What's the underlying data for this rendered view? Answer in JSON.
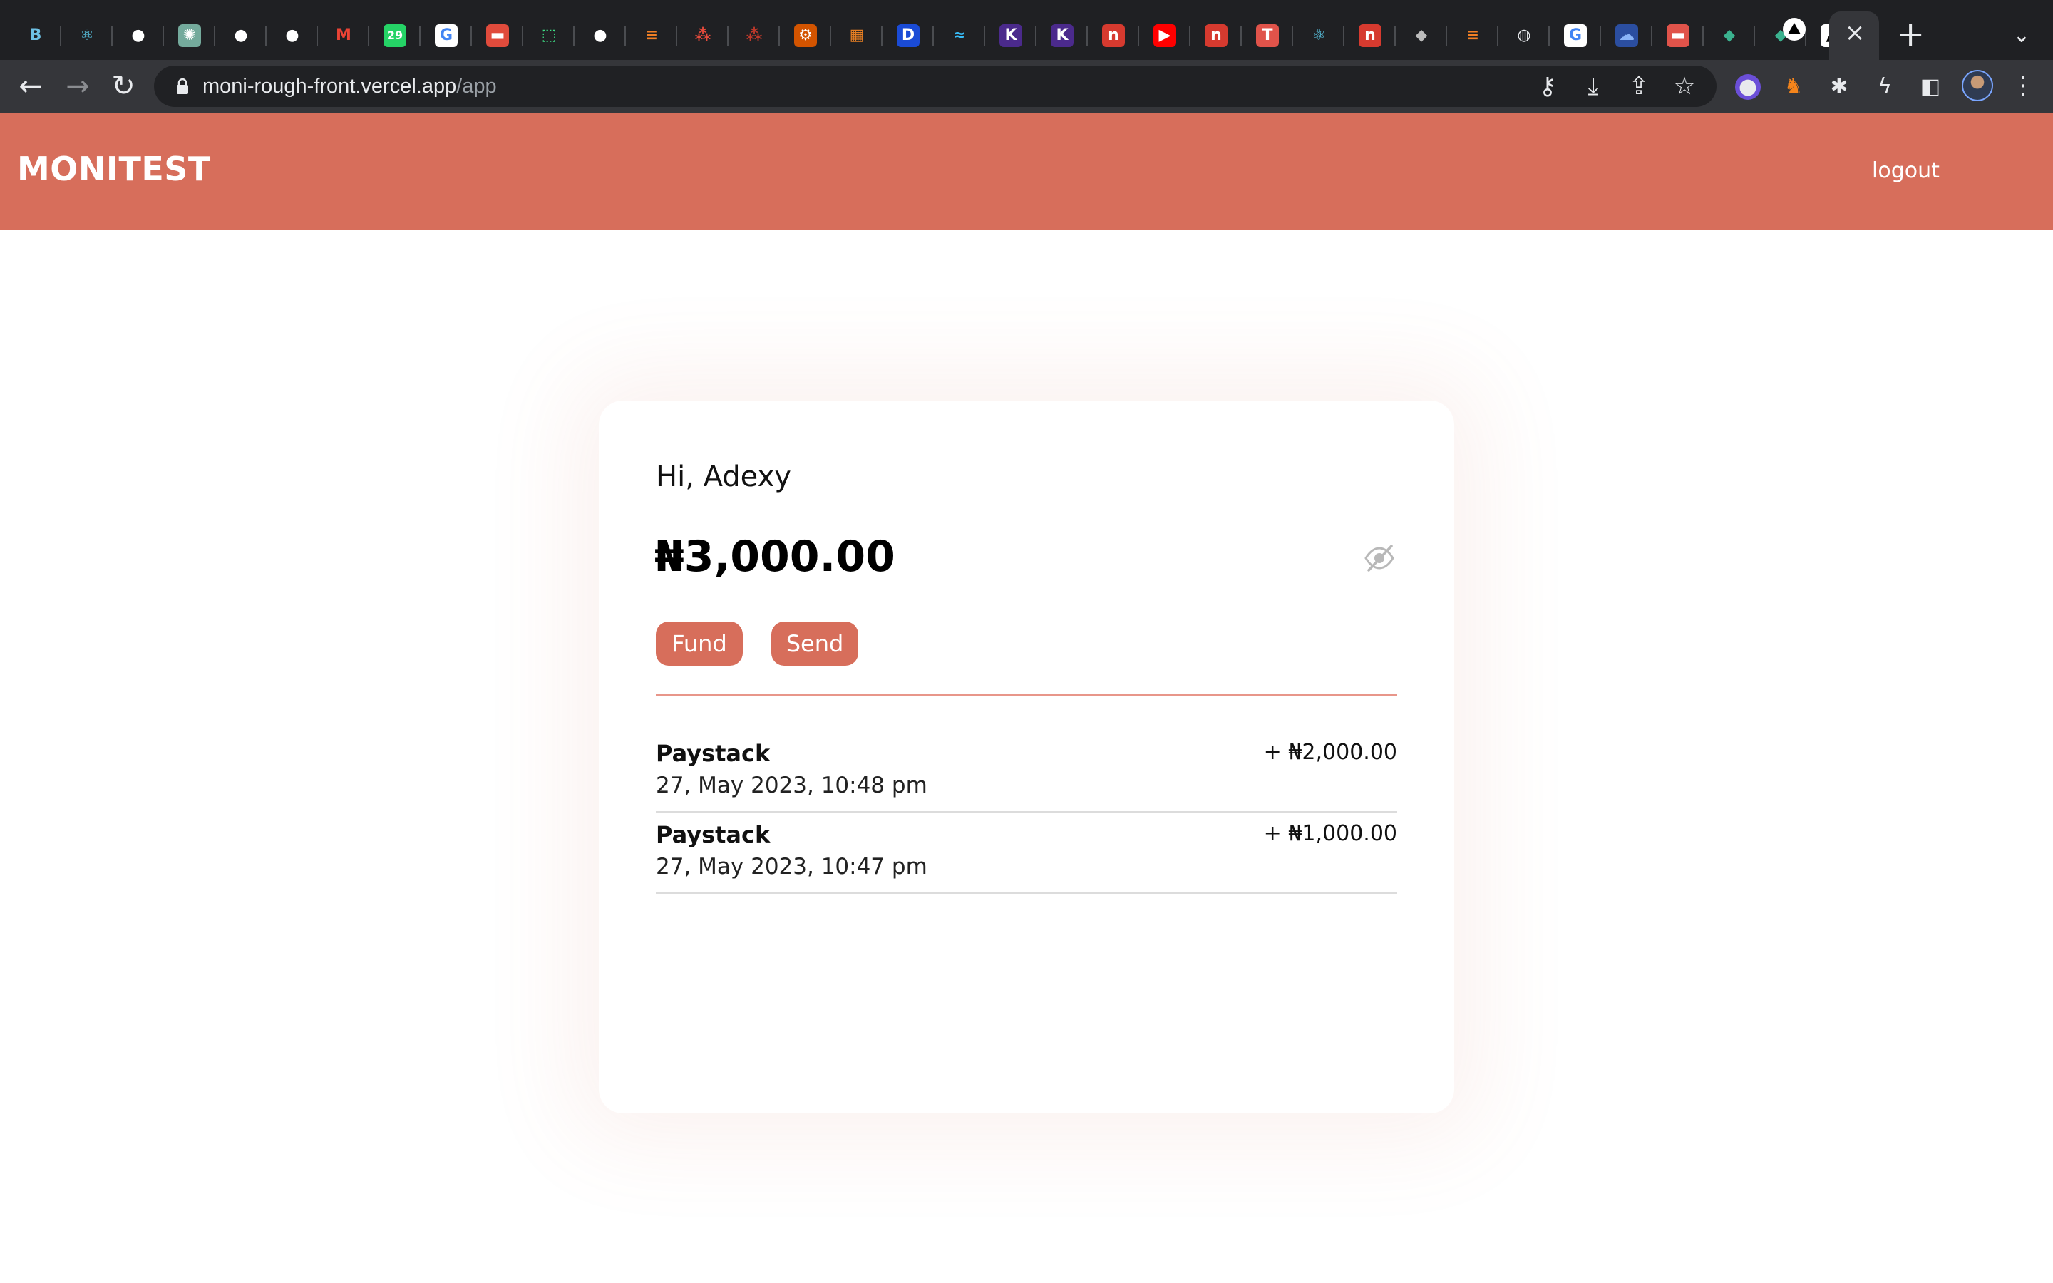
{
  "browser": {
    "tab_favicons": [
      {
        "icon": "bootstrap-icon",
        "glyph": "B",
        "color": "#6ec1e4",
        "bg": "transparent"
      },
      {
        "icon": "react-icon",
        "glyph": "⚛",
        "color": "#61dafb",
        "bg": "transparent"
      },
      {
        "icon": "github-icon",
        "glyph": "●",
        "color": "#ffffff",
        "bg": "transparent"
      },
      {
        "icon": "chatgpt-icon",
        "glyph": "✺",
        "color": "#ffffff",
        "bg": "#74aa9c"
      },
      {
        "icon": "github-icon",
        "glyph": "●",
        "color": "#ffffff",
        "bg": "transparent"
      },
      {
        "icon": "github-icon",
        "glyph": "●",
        "color": "#ffffff",
        "bg": "transparent"
      },
      {
        "icon": "gmail-icon",
        "glyph": "M",
        "color": "#ea4335",
        "bg": "transparent"
      },
      {
        "icon": "whatsapp-icon",
        "glyph": "29",
        "color": "#ffffff",
        "bg": "#25d366"
      },
      {
        "icon": "google-icon",
        "glyph": "G",
        "color": "#4285f4",
        "bg": "#ffffff"
      },
      {
        "icon": "red-app-icon",
        "glyph": "▬",
        "color": "#ffffff",
        "bg": "#e04b3c"
      },
      {
        "icon": "crop-icon",
        "glyph": "⬚",
        "color": "#3ddc84",
        "bg": "transparent"
      },
      {
        "icon": "github-icon",
        "glyph": "●",
        "color": "#ffffff",
        "bg": "transparent"
      },
      {
        "icon": "stackoverflow-icon",
        "glyph": "≡",
        "color": "#f48024",
        "bg": "transparent"
      },
      {
        "icon": "dots-app-icon",
        "glyph": "⁂",
        "color": "#e84b3c",
        "bg": "transparent"
      },
      {
        "icon": "dots-app-icon",
        "glyph": "⁂",
        "color": "#c0392b",
        "bg": "transparent"
      },
      {
        "icon": "gear-app-icon",
        "glyph": "⚙",
        "color": "#ffffff",
        "bg": "#d35400"
      },
      {
        "icon": "store-icon",
        "glyph": "▦",
        "color": "#e67e22",
        "bg": "transparent"
      },
      {
        "icon": "devtools-icon",
        "glyph": "D",
        "color": "#ffffff",
        "bg": "#1a4bd6"
      },
      {
        "icon": "tailwind-icon",
        "glyph": "≈",
        "color": "#38bdf8",
        "bg": "transparent"
      },
      {
        "icon": "kotlin-icon",
        "glyph": "K",
        "color": "#ffffff",
        "bg": "#4b2a8c"
      },
      {
        "icon": "kotlin-icon",
        "glyph": "K",
        "color": "#ffffff",
        "bg": "#4b2a8c"
      },
      {
        "icon": "notion-icon",
        "glyph": "n",
        "color": "#ffffff",
        "bg": "#d63a2f"
      },
      {
        "icon": "youtube-icon",
        "glyph": "▶",
        "color": "#ffffff",
        "bg": "#ff0000"
      },
      {
        "icon": "notion-icon",
        "glyph": "n",
        "color": "#ffffff",
        "bg": "#d63a2f"
      },
      {
        "icon": "t-app-icon",
        "glyph": "T",
        "color": "#ffffff",
        "bg": "#e0534a"
      },
      {
        "icon": "react-icon",
        "glyph": "⚛",
        "color": "#61dafb",
        "bg": "transparent"
      },
      {
        "icon": "notion-icon",
        "glyph": "n",
        "color": "#ffffff",
        "bg": "#d63a2f"
      },
      {
        "icon": "box-icon",
        "glyph": "◆",
        "color": "#bbbbbb",
        "bg": "transparent"
      },
      {
        "icon": "stackoverflow-icon",
        "glyph": "≡",
        "color": "#f48024",
        "bg": "transparent"
      },
      {
        "icon": "globe-icon",
        "glyph": "◍",
        "color": "#e8eaed",
        "bg": "transparent"
      },
      {
        "icon": "google-icon",
        "glyph": "G",
        "color": "#4285f4",
        "bg": "#ffffff"
      },
      {
        "icon": "cloud-icon",
        "glyph": "☁",
        "color": "#8ab4f8",
        "bg": "#2b4ea0"
      },
      {
        "icon": "pay-app-icon",
        "glyph": "▬",
        "color": "#ffffff",
        "bg": "#e0534a"
      },
      {
        "icon": "diamond-icon",
        "glyph": "◆",
        "color": "#3bb28f",
        "bg": "transparent"
      },
      {
        "icon": "diamond-icon",
        "glyph": "◆",
        "color": "#3bb28f",
        "bg": "transparent"
      },
      {
        "icon": "vercel-icon",
        "glyph": "▲",
        "color": "#000000",
        "bg": "#ffffff"
      }
    ],
    "url_host": "moni-rough-front.vercel.app",
    "url_path": "/app"
  },
  "header": {
    "brand": "MONITEST",
    "logout_label": "logout"
  },
  "card": {
    "greeting": "Hi, Adexy",
    "balance": "₦3,000.00",
    "fund_label": "Fund",
    "send_label": "Send"
  },
  "transactions": [
    {
      "name": "Paystack",
      "date": "27, May 2023, 10:48 pm",
      "amount": "+ ₦2,000.00"
    },
    {
      "name": "Paystack",
      "date": "27, May 2023, 10:47 pm",
      "amount": "+ ₦1,000.00"
    }
  ],
  "colors": {
    "accent": "#d76e5b",
    "tabstrip_bg": "#1f2023",
    "toolbar_bg": "#35363a"
  }
}
